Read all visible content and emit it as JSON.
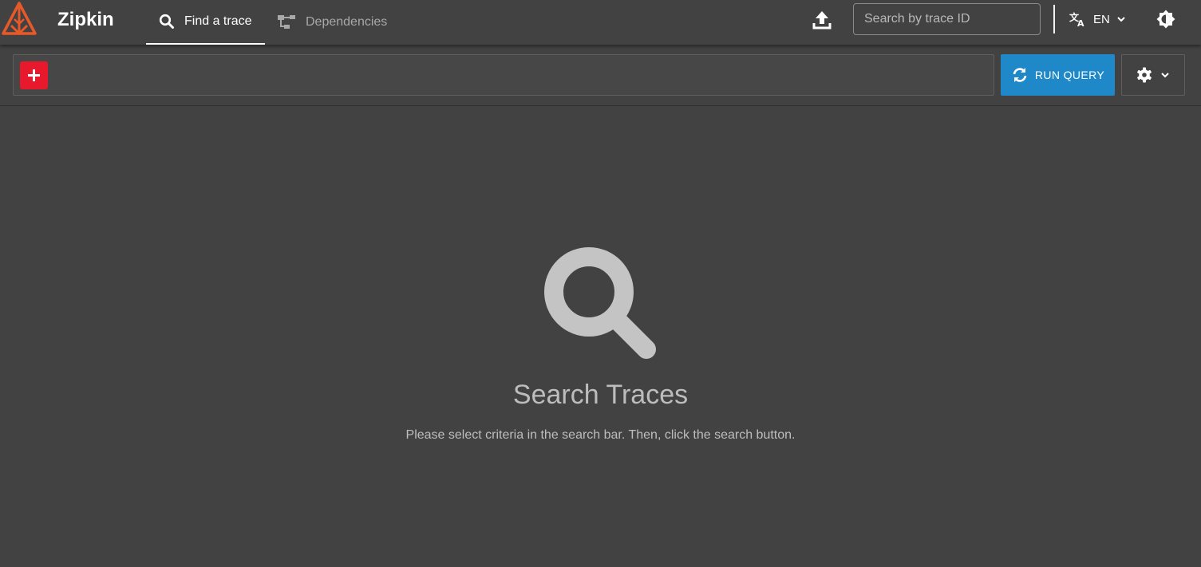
{
  "app": {
    "name": "Zipkin",
    "brand_color": "#e8592a"
  },
  "header": {
    "tabs": [
      {
        "label": "Find a trace",
        "icon": "search-icon",
        "active": true
      },
      {
        "label": "Dependencies",
        "icon": "dependencies-icon",
        "active": false
      }
    ],
    "upload_icon": "upload-icon",
    "trace_search": {
      "placeholder": "Search by trace ID",
      "value": ""
    },
    "language": {
      "label": "EN",
      "icon": "translate-icon"
    },
    "theme_icon": "theme-toggle-icon"
  },
  "filter_bar": {
    "add_button_icon": "plus-icon",
    "add_button_color": "#e8192c",
    "run_query": {
      "label": "RUN QUERY",
      "icon": "refresh-icon",
      "color": "#1f88c9"
    },
    "settings_icon": "gear-icon"
  },
  "empty_state": {
    "icon": "search-icon",
    "title": "Search Traces",
    "description": "Please select criteria in the search bar. Then, click the search button."
  }
}
